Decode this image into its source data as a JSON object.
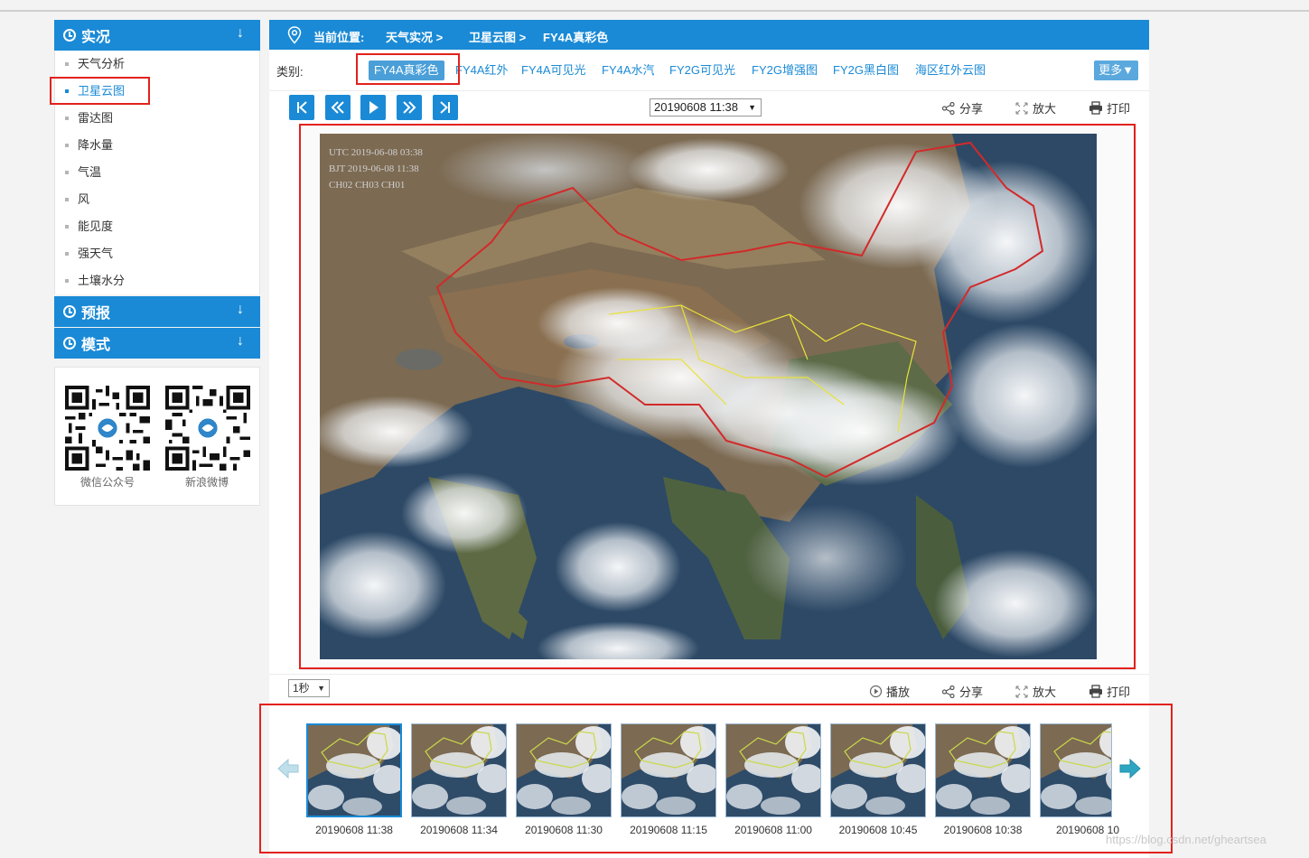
{
  "sidebar": {
    "section_live": "实况",
    "section_forecast": "预报",
    "section_model": "模式",
    "arrow": "↓",
    "items": [
      {
        "label": "天气分析"
      },
      {
        "label": "卫星云图"
      },
      {
        "label": "雷达图"
      },
      {
        "label": "降水量"
      },
      {
        "label": "气温"
      },
      {
        "label": "风"
      },
      {
        "label": "能见度"
      },
      {
        "label": "强天气"
      },
      {
        "label": "土壤水分"
      }
    ],
    "active_index": 1,
    "qr_wechat": "微信公众号",
    "qr_weibo": "新浪微博"
  },
  "breadcrumb": {
    "prefix": "当前位置:",
    "level1": "天气实况 >",
    "level2": "卫星云图 >",
    "level3": "FY4A真彩色"
  },
  "categories": {
    "label": "类别:",
    "items": [
      "FY4A真彩色",
      "FY4A红外",
      "FY4A可见光",
      "FY4A水汽",
      "FY2G可见光",
      "FY2G增强图",
      "FY2G黑白图",
      "海区红外云图"
    ],
    "more": "更多▼"
  },
  "controls": {
    "time_value": "20190608 11:38",
    "share": "分享",
    "zoom": "放大",
    "print": "打印",
    "play": "播放",
    "speed_value": "1秒"
  },
  "image_overlay": {
    "utc": "UTC 2019-06-08 03:38",
    "bjt": "BJT 2019-06-08 11:38",
    "channels": "CH02 CH03 CH01"
  },
  "thumbnails": [
    {
      "label": "20190608 11:38"
    },
    {
      "label": "20190608 11:34"
    },
    {
      "label": "20190608 11:30"
    },
    {
      "label": "20190608 11:15"
    },
    {
      "label": "20190608 11:00"
    },
    {
      "label": "20190608 10:45"
    },
    {
      "label": "20190608 10:38"
    },
    {
      "label": "20190608 10"
    }
  ],
  "watermark": "https://blog.csdn.net/gheartsea",
  "colors": {
    "accent": "#1a8ad6",
    "annotation": "#e2221d"
  }
}
